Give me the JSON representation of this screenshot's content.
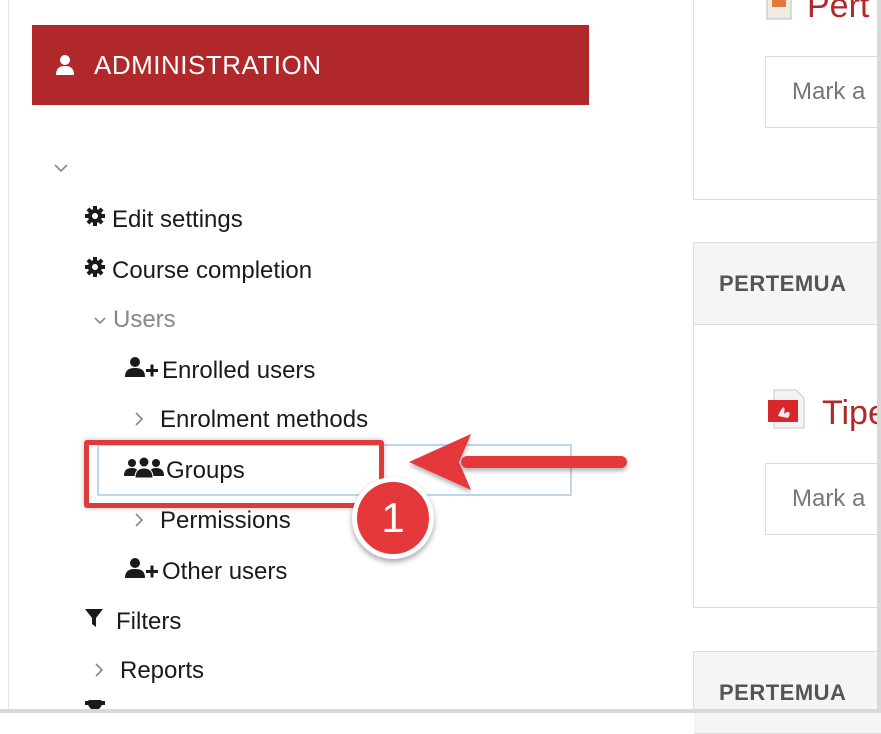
{
  "admin_block": {
    "title": "ADMINISTRATION",
    "color": "#b0282a"
  },
  "tree": {
    "collapse_icon": "chevron-down-icon",
    "items": [
      {
        "label": "Edit settings",
        "icon": "gear-icon"
      },
      {
        "label": "Course completion",
        "icon": "gear-icon"
      },
      {
        "label": "Users",
        "icon": "chevron-down-icon"
      },
      {
        "label": "Enrolled users",
        "icon": "user-plus-icon"
      },
      {
        "label": "Enrolment methods",
        "icon": "chevron-right-icon"
      },
      {
        "label": "Groups",
        "icon": "users-icon"
      },
      {
        "label": "Permissions",
        "icon": "chevron-right-icon"
      },
      {
        "label": "Other users",
        "icon": "user-plus-icon"
      },
      {
        "label": "Filters",
        "icon": "filter-icon"
      },
      {
        "label": "Reports",
        "icon": "chevron-right-icon"
      }
    ]
  },
  "right": {
    "top_resource": "Pert",
    "mark_text_1": "Mark a",
    "section_1": "PERTEMUA",
    "resource_1": "Tipe",
    "mark_text_2": "Mark a",
    "section_2": "PERTEMUA"
  },
  "annotation": {
    "step_number": "1",
    "color": "#e5383b"
  }
}
